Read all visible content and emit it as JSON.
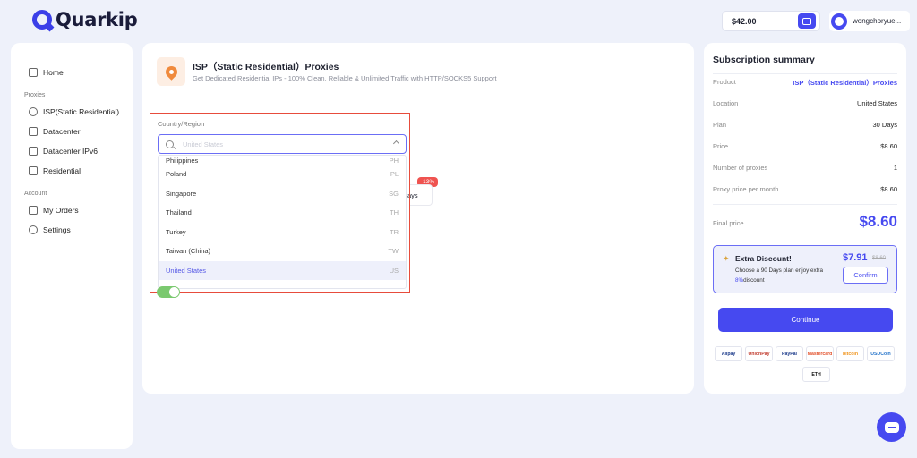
{
  "header": {
    "logo_text": "Quarkip",
    "balance": "$42.00",
    "username": "wongchoryue..."
  },
  "sidebar": {
    "home": "Home",
    "section_proxies": "Proxies",
    "isp": "ISP(Static Residential)",
    "datacenter": "Datacenter",
    "datacenter_ipv6": "Datacenter IPv6",
    "residential": "Residential",
    "section_account": "Account",
    "orders": "My Orders",
    "settings": "Settings"
  },
  "product": {
    "title": "ISP（Static Residential）Proxies",
    "subtitle": "Get Dedicated Residential IPs - 100% Clean, Reliable & Unlimited Traffic with HTTP/SOCKS5 Support"
  },
  "region": {
    "label": "Country/Region",
    "placeholder": "United States",
    "options": [
      {
        "name": "Philippines",
        "code": "PH"
      },
      {
        "name": "Poland",
        "code": "PL"
      },
      {
        "name": "Singapore",
        "code": "SG"
      },
      {
        "name": "Thailand",
        "code": "TH"
      },
      {
        "name": "Turkey",
        "code": "TR"
      },
      {
        "name": "Taiwan (China)",
        "code": "TW"
      },
      {
        "name": "United States",
        "code": "US"
      }
    ]
  },
  "plan_option": {
    "badge": "-13%",
    "days_partial": "ays"
  },
  "summary": {
    "title": "Subscription summary",
    "product_k": "Product",
    "product_v": "ISP（Static Residential）Proxies",
    "location_k": "Location",
    "location_v": "United States",
    "plan_k": "Plan",
    "plan_v": "30 Days",
    "price_k": "Price",
    "price_v": "$8.60",
    "num_k": "Number of proxies",
    "num_v": "1",
    "ppm_k": "Proxy price per month",
    "ppm_v": "$8.60",
    "final_k": "Final price",
    "final_v": "$8.60"
  },
  "discount": {
    "title": "Extra Discount!",
    "text_a": "Choose a 90 Days plan enjoy extra",
    "percent": "8%",
    "text_b": "discount",
    "price": "$7.91",
    "old_price": "$8.60",
    "confirm": "Confirm"
  },
  "continue_label": "Continue",
  "payments": [
    "Alipay",
    "UnionPay",
    "PayPal",
    "Mastercard",
    "bitcoin",
    "USDCoin",
    "ETH"
  ]
}
